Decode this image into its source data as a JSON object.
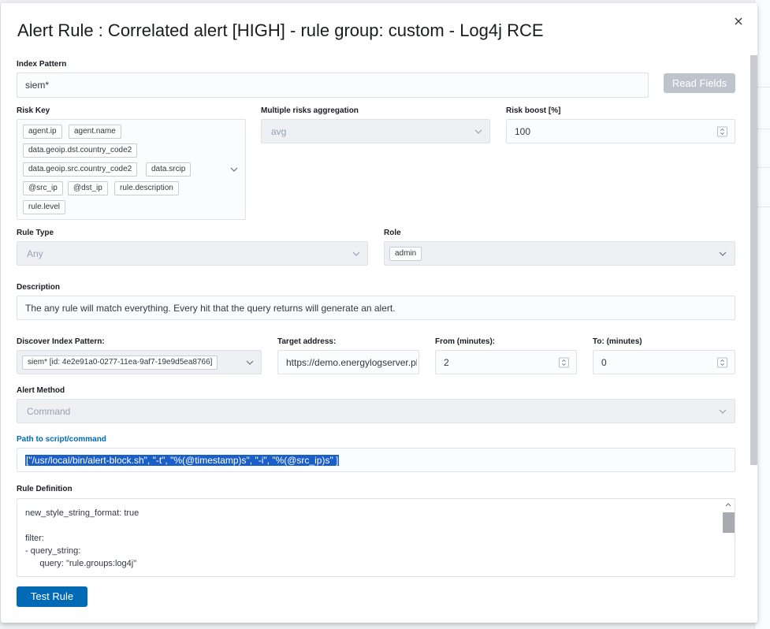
{
  "modal": {
    "title": "Alert Rule : Correlated alert [HIGH] - rule group: custom - Log4j RCE",
    "close_icon": "close-icon"
  },
  "index_pattern": {
    "label": "Index Pattern",
    "value": "siem*",
    "read_fields_label": "Read Fields"
  },
  "risk_key": {
    "label": "Risk Key",
    "chips": [
      "agent.ip",
      "agent.name",
      "data.geoip.dst.country_code2",
      "data.geoip.src.country_code2",
      "data.srcip",
      "@src_ip",
      "@dst_ip",
      "rule.description",
      "rule.level"
    ]
  },
  "aggregation": {
    "label": "Multiple risks aggregation",
    "value": "avg"
  },
  "risk_boost": {
    "label": "Risk boost [%]",
    "value": "100"
  },
  "rule_type": {
    "label": "Rule Type",
    "value": "Any"
  },
  "role": {
    "label": "Role",
    "chips": [
      "admin"
    ]
  },
  "description": {
    "label": "Description",
    "value": "The any rule will match everything. Every hit that the query returns will generate an alert."
  },
  "discover": {
    "label": "Discover Index Pattern:",
    "chip": "siem* [id: 4e2e91a0-0277-11ea-9af7-19e9d5ea8766]"
  },
  "target": {
    "label": "Target address:",
    "value": "https://demo.energylogserver.pl"
  },
  "from": {
    "label": "From (minutes):",
    "value": "2"
  },
  "to": {
    "label": "To: (minutes)",
    "value": "0"
  },
  "alert_method": {
    "label": "Alert Method",
    "value": "Command"
  },
  "script_path": {
    "label": "Path to script/command",
    "value": "[\"/usr/local/bin/alert-block.sh\", \"-t\", \"%(@timestamp)s\", \"-i\", \"%(@src_ip)s\" ]"
  },
  "rule_definition": {
    "label": "Rule Definition",
    "lines": [
      "new_style_string_format: true",
      "",
      "filter:",
      "- query_string:",
      "      query: \"rule.groups:log4j\""
    ]
  },
  "test_rule_label": "Test Rule",
  "colors": {
    "primary": "#006bb4",
    "selection": "#1a5fc8",
    "disabled_bg": "#eef0f3"
  }
}
